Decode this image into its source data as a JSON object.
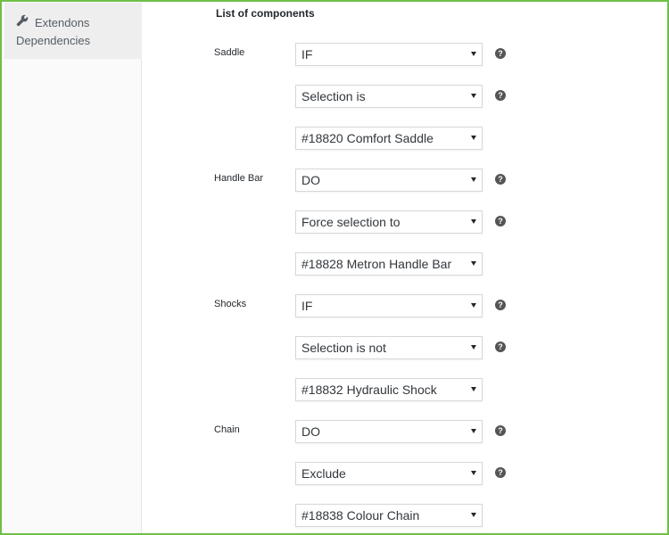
{
  "sidebar": {
    "items": [
      {
        "label": "Extendons Dependencies",
        "icon": "wrench-icon"
      }
    ]
  },
  "main": {
    "heading": "List of components",
    "help_glyph": "?",
    "components": [
      {
        "name": "Saddle",
        "condition": "IF",
        "rule": "Selection is",
        "product": "#18820 Comfort Saddle"
      },
      {
        "name": "Handle Bar",
        "condition": "DO",
        "rule": "Force selection to",
        "product": "#18828 Metron Handle Bar"
      },
      {
        "name": "Shocks",
        "condition": "IF",
        "rule": "Selection is not",
        "product": "#18832 Hydraulic Shock"
      },
      {
        "name": "Chain",
        "condition": "DO",
        "rule": "Exclude",
        "product": "#18838 Colour Chain"
      }
    ]
  },
  "colors": {
    "frame_border": "#6fbf47",
    "sidebar_bg": "#fafafa",
    "sidebar_item_bg": "#eeeeee",
    "help_icon_bg": "#555555"
  }
}
